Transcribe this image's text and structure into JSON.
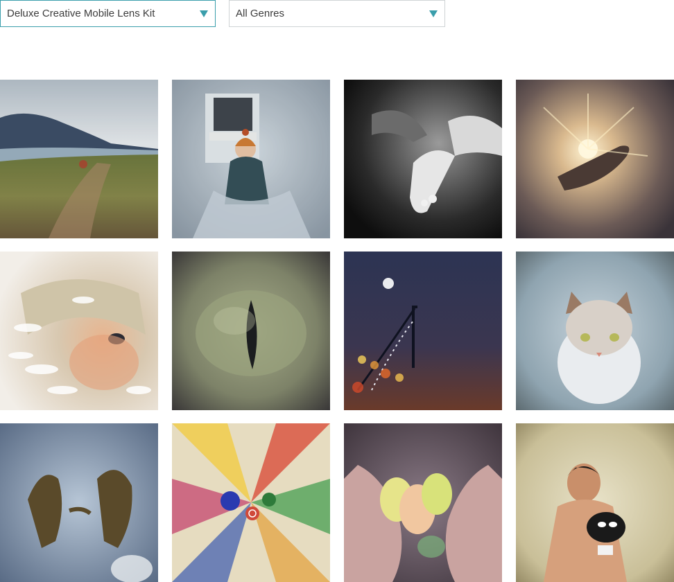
{
  "filters": {
    "lens_select": {
      "selected": "Deluxe Creative Mobile Lens Kit"
    },
    "genre_select": {
      "selected": "All Genres"
    }
  },
  "gallery": {
    "photos": [
      {
        "icon": "photo-landscape-river"
      },
      {
        "icon": "photo-child-window"
      },
      {
        "icon": "photo-baby-feet-bw"
      },
      {
        "icon": "photo-hand-sunlight"
      },
      {
        "icon": "photo-child-zoom-blur"
      },
      {
        "icon": "photo-eye-closeup"
      },
      {
        "icon": "photo-bridge-night"
      },
      {
        "icon": "photo-cat-portrait"
      },
      {
        "icon": "photo-couple-reflection"
      },
      {
        "icon": "photo-kaleidoscope-flowers"
      },
      {
        "icon": "photo-hands-balloons"
      },
      {
        "icon": "photo-boy-with-cat"
      }
    ]
  },
  "colors": {
    "accent": "#3a9eab",
    "border_inactive": "#cfd3d5",
    "text": "#3b3b3b"
  }
}
